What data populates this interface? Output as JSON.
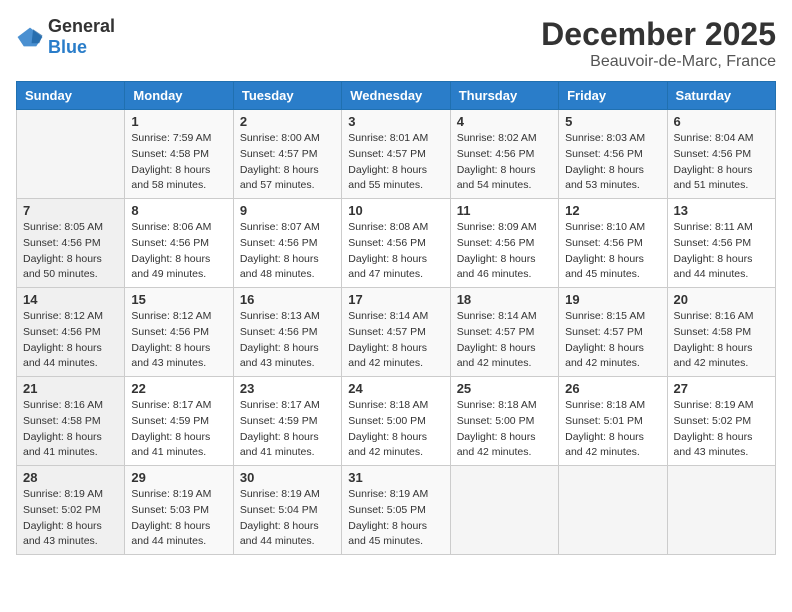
{
  "logo": {
    "general": "General",
    "blue": "Blue"
  },
  "title": {
    "month": "December 2025",
    "location": "Beauvoir-de-Marc, France"
  },
  "weekdays": [
    "Sunday",
    "Monday",
    "Tuesday",
    "Wednesday",
    "Thursday",
    "Friday",
    "Saturday"
  ],
  "weeks": [
    [
      {
        "day": "",
        "sunrise": "",
        "sunset": "",
        "daylight": ""
      },
      {
        "day": "1",
        "sunrise": "Sunrise: 7:59 AM",
        "sunset": "Sunset: 4:58 PM",
        "daylight": "Daylight: 8 hours and 58 minutes."
      },
      {
        "day": "2",
        "sunrise": "Sunrise: 8:00 AM",
        "sunset": "Sunset: 4:57 PM",
        "daylight": "Daylight: 8 hours and 57 minutes."
      },
      {
        "day": "3",
        "sunrise": "Sunrise: 8:01 AM",
        "sunset": "Sunset: 4:57 PM",
        "daylight": "Daylight: 8 hours and 55 minutes."
      },
      {
        "day": "4",
        "sunrise": "Sunrise: 8:02 AM",
        "sunset": "Sunset: 4:56 PM",
        "daylight": "Daylight: 8 hours and 54 minutes."
      },
      {
        "day": "5",
        "sunrise": "Sunrise: 8:03 AM",
        "sunset": "Sunset: 4:56 PM",
        "daylight": "Daylight: 8 hours and 53 minutes."
      },
      {
        "day": "6",
        "sunrise": "Sunrise: 8:04 AM",
        "sunset": "Sunset: 4:56 PM",
        "daylight": "Daylight: 8 hours and 51 minutes."
      }
    ],
    [
      {
        "day": "7",
        "sunrise": "Sunrise: 8:05 AM",
        "sunset": "Sunset: 4:56 PM",
        "daylight": "Daylight: 8 hours and 50 minutes."
      },
      {
        "day": "8",
        "sunrise": "Sunrise: 8:06 AM",
        "sunset": "Sunset: 4:56 PM",
        "daylight": "Daylight: 8 hours and 49 minutes."
      },
      {
        "day": "9",
        "sunrise": "Sunrise: 8:07 AM",
        "sunset": "Sunset: 4:56 PM",
        "daylight": "Daylight: 8 hours and 48 minutes."
      },
      {
        "day": "10",
        "sunrise": "Sunrise: 8:08 AM",
        "sunset": "Sunset: 4:56 PM",
        "daylight": "Daylight: 8 hours and 47 minutes."
      },
      {
        "day": "11",
        "sunrise": "Sunrise: 8:09 AM",
        "sunset": "Sunset: 4:56 PM",
        "daylight": "Daylight: 8 hours and 46 minutes."
      },
      {
        "day": "12",
        "sunrise": "Sunrise: 8:10 AM",
        "sunset": "Sunset: 4:56 PM",
        "daylight": "Daylight: 8 hours and 45 minutes."
      },
      {
        "day": "13",
        "sunrise": "Sunrise: 8:11 AM",
        "sunset": "Sunset: 4:56 PM",
        "daylight": "Daylight: 8 hours and 44 minutes."
      }
    ],
    [
      {
        "day": "14",
        "sunrise": "Sunrise: 8:12 AM",
        "sunset": "Sunset: 4:56 PM",
        "daylight": "Daylight: 8 hours and 44 minutes."
      },
      {
        "day": "15",
        "sunrise": "Sunrise: 8:12 AM",
        "sunset": "Sunset: 4:56 PM",
        "daylight": "Daylight: 8 hours and 43 minutes."
      },
      {
        "day": "16",
        "sunrise": "Sunrise: 8:13 AM",
        "sunset": "Sunset: 4:56 PM",
        "daylight": "Daylight: 8 hours and 43 minutes."
      },
      {
        "day": "17",
        "sunrise": "Sunrise: 8:14 AM",
        "sunset": "Sunset: 4:57 PM",
        "daylight": "Daylight: 8 hours and 42 minutes."
      },
      {
        "day": "18",
        "sunrise": "Sunrise: 8:14 AM",
        "sunset": "Sunset: 4:57 PM",
        "daylight": "Daylight: 8 hours and 42 minutes."
      },
      {
        "day": "19",
        "sunrise": "Sunrise: 8:15 AM",
        "sunset": "Sunset: 4:57 PM",
        "daylight": "Daylight: 8 hours and 42 minutes."
      },
      {
        "day": "20",
        "sunrise": "Sunrise: 8:16 AM",
        "sunset": "Sunset: 4:58 PM",
        "daylight": "Daylight: 8 hours and 42 minutes."
      }
    ],
    [
      {
        "day": "21",
        "sunrise": "Sunrise: 8:16 AM",
        "sunset": "Sunset: 4:58 PM",
        "daylight": "Daylight: 8 hours and 41 minutes."
      },
      {
        "day": "22",
        "sunrise": "Sunrise: 8:17 AM",
        "sunset": "Sunset: 4:59 PM",
        "daylight": "Daylight: 8 hours and 41 minutes."
      },
      {
        "day": "23",
        "sunrise": "Sunrise: 8:17 AM",
        "sunset": "Sunset: 4:59 PM",
        "daylight": "Daylight: 8 hours and 41 minutes."
      },
      {
        "day": "24",
        "sunrise": "Sunrise: 8:18 AM",
        "sunset": "Sunset: 5:00 PM",
        "daylight": "Daylight: 8 hours and 42 minutes."
      },
      {
        "day": "25",
        "sunrise": "Sunrise: 8:18 AM",
        "sunset": "Sunset: 5:00 PM",
        "daylight": "Daylight: 8 hours and 42 minutes."
      },
      {
        "day": "26",
        "sunrise": "Sunrise: 8:18 AM",
        "sunset": "Sunset: 5:01 PM",
        "daylight": "Daylight: 8 hours and 42 minutes."
      },
      {
        "day": "27",
        "sunrise": "Sunrise: 8:19 AM",
        "sunset": "Sunset: 5:02 PM",
        "daylight": "Daylight: 8 hours and 43 minutes."
      }
    ],
    [
      {
        "day": "28",
        "sunrise": "Sunrise: 8:19 AM",
        "sunset": "Sunset: 5:02 PM",
        "daylight": "Daylight: 8 hours and 43 minutes."
      },
      {
        "day": "29",
        "sunrise": "Sunrise: 8:19 AM",
        "sunset": "Sunset: 5:03 PM",
        "daylight": "Daylight: 8 hours and 44 minutes."
      },
      {
        "day": "30",
        "sunrise": "Sunrise: 8:19 AM",
        "sunset": "Sunset: 5:04 PM",
        "daylight": "Daylight: 8 hours and 44 minutes."
      },
      {
        "day": "31",
        "sunrise": "Sunrise: 8:19 AM",
        "sunset": "Sunset: 5:05 PM",
        "daylight": "Daylight: 8 hours and 45 minutes."
      },
      {
        "day": "",
        "sunrise": "",
        "sunset": "",
        "daylight": ""
      },
      {
        "day": "",
        "sunrise": "",
        "sunset": "",
        "daylight": ""
      },
      {
        "day": "",
        "sunrise": "",
        "sunset": "",
        "daylight": ""
      }
    ]
  ]
}
